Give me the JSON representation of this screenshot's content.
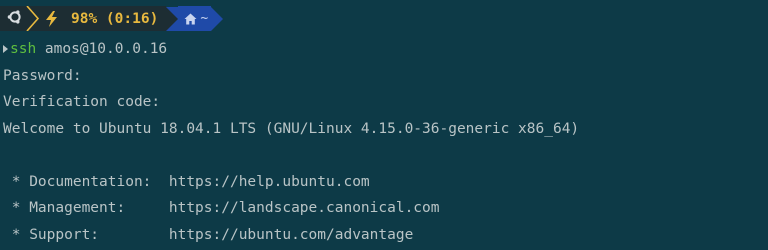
{
  "prompt": {
    "os_icon": "ubuntu-logo-icon",
    "battery_icon": "lightning-bolt-icon",
    "battery_text": "98% (0:16)",
    "home_icon": "home-icon",
    "directory": "~",
    "colors": {
      "os_segment_bg": "#1d2d33",
      "battery_text": "#e8b93f",
      "dir_segment_bg": "#1f4aa8"
    }
  },
  "command": {
    "name": "ssh",
    "args": " amos@10.0.0.16",
    "color": "#5fbf3f"
  },
  "output": [
    "Password:",
    "Verification code:",
    "Welcome to Ubuntu 18.04.1 LTS (GNU/Linux 4.15.0-36-generic x86_64)",
    "",
    " * Documentation:  https://help.ubuntu.com",
    " * Management:     https://landscape.canonical.com",
    " * Support:        https://ubuntu.com/advantage"
  ],
  "background_color": "#0d3a47"
}
